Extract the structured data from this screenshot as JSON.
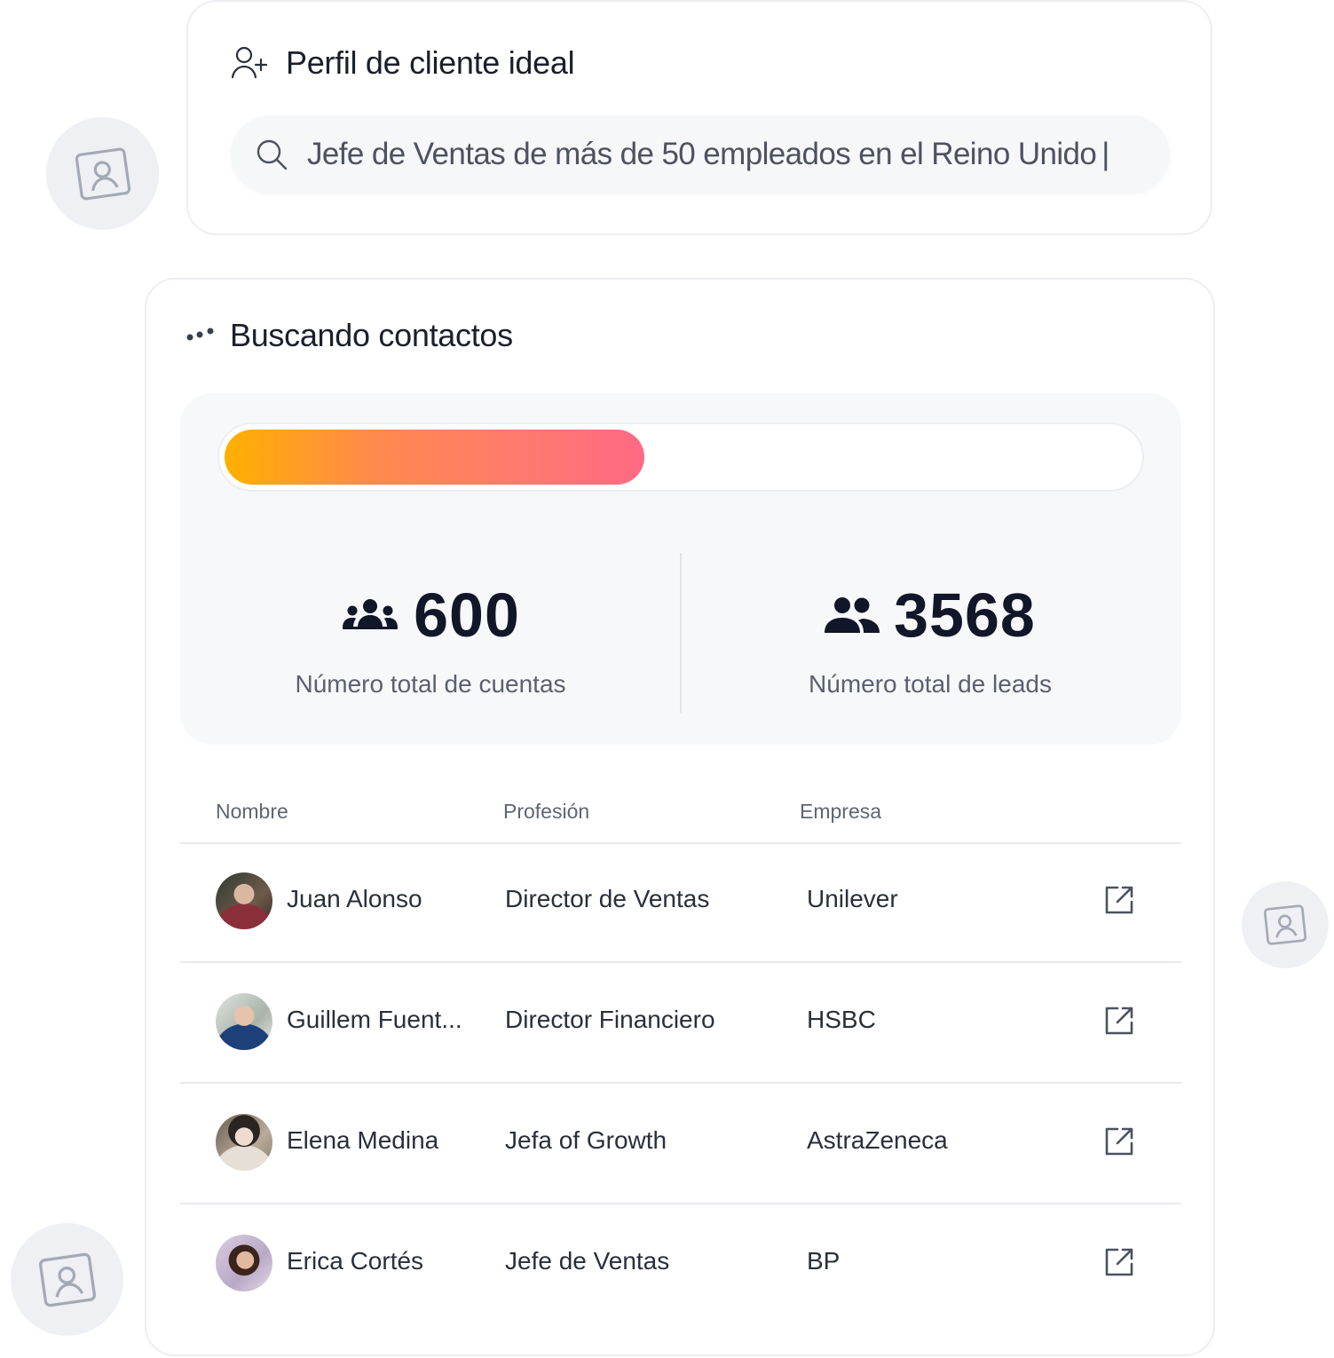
{
  "icp": {
    "title": "Perfil de cliente ideal",
    "search_value": "Jefe de Ventas de más de 50 empleados en el Reino Unido",
    "caret": "|"
  },
  "search": {
    "title": "Buscando contactos",
    "progress_percent": 46,
    "accounts": {
      "value": "600",
      "label": "Número total de cuentas",
      "icon": "group-icon"
    },
    "leads": {
      "value": "3568",
      "label": "Número total de leads",
      "icon": "people-icon"
    }
  },
  "table": {
    "headers": {
      "name": "Nombre",
      "profession": "Profesión",
      "company": "Empresa"
    },
    "rows": [
      {
        "name": "Juan Alonso",
        "profession": "Director de Ventas",
        "company": "Unilever"
      },
      {
        "name": "Guillem Fuent...",
        "profession": "Director Financiero",
        "company": "HSBC"
      },
      {
        "name": "Elena Medina",
        "profession": "Jefa of Growth",
        "company": "AstraZeneca"
      },
      {
        "name": "Erica Cortés",
        "profession": "Jefe de Ventas",
        "company": "BP"
      }
    ]
  },
  "colors": {
    "progress_start": "#ffb000",
    "progress_end": "#ff6a84",
    "stat_number": "#111629"
  }
}
